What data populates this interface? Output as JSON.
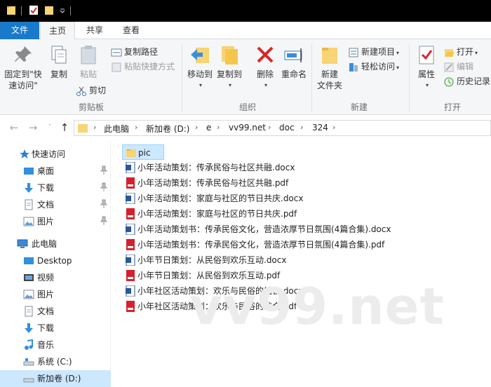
{
  "ribbon_tabs": [
    "文件",
    "主页",
    "共享",
    "查看"
  ],
  "clipboard": {
    "pin_label_1": "固定到\"快",
    "pin_label_2": "速访问\"",
    "copy": "复制",
    "paste": "粘贴",
    "copy_path": "复制路径",
    "paste_shortcut": "粘贴快捷方式",
    "cut": "剪切",
    "group": "剪贴板"
  },
  "organize": {
    "move_to": "移动到",
    "copy_to": "复制到",
    "delete": "删除",
    "rename": "重命名",
    "group": "组织"
  },
  "new": {
    "new_folder_1": "新建",
    "new_folder_2": "文件夹",
    "new_item": "新建项目",
    "easy_access": "轻松访问",
    "group": "新建"
  },
  "open": {
    "properties": "属性",
    "open": "打开",
    "edit": "编辑",
    "history": "历史记录",
    "group": "打开"
  },
  "breadcrumb": [
    "此电脑",
    "新加卷 (D:)",
    "e",
    "vv99.net",
    "doc",
    "324"
  ],
  "sidebar": {
    "quick_access": "快速访问",
    "quick_items": [
      "桌面",
      "下载",
      "文档",
      "图片"
    ],
    "this_pc": "此电脑",
    "pc_items": [
      "Desktop",
      "视频",
      "图片",
      "文档",
      "下载",
      "音乐",
      "系统 (C:)",
      "新加卷 (D:)"
    ]
  },
  "files": [
    {
      "name": "pic",
      "type": "folder"
    },
    {
      "name": "小年活动策划：传承民俗与社区共融.docx",
      "type": "docx"
    },
    {
      "name": "小年活动策划：传承民俗与社区共融.pdf",
      "type": "pdf"
    },
    {
      "name": "小年活动策划：家庭与社区的节日共庆.docx",
      "type": "docx"
    },
    {
      "name": "小年活动策划：家庭与社区的节日共庆.pdf",
      "type": "pdf"
    },
    {
      "name": "小年活动策划书：传承民俗文化，营造浓厚节日氛围(4篇合集).docx",
      "type": "docx"
    },
    {
      "name": "小年活动策划书：传承民俗文化，营造浓厚节日氛围(4篇合集).pdf",
      "type": "pdf"
    },
    {
      "name": "小年节日策划：从民俗到欢乐互动.docx",
      "type": "docx"
    },
    {
      "name": "小年节日策划：从民俗到欢乐互动.pdf",
      "type": "pdf"
    },
    {
      "name": "小年社区活动策划：欢乐与民俗的结合.docx",
      "type": "docx"
    },
    {
      "name": "小年社区活动策划：欢乐与民俗的结合.pdf",
      "type": "pdf"
    }
  ],
  "watermark": "vv99.net",
  "colors": {
    "accent": "#1979ca",
    "selection": "#cce8ff",
    "folder": "#f7d474",
    "pdf": "#d6202d",
    "docx": "#2b579a"
  }
}
